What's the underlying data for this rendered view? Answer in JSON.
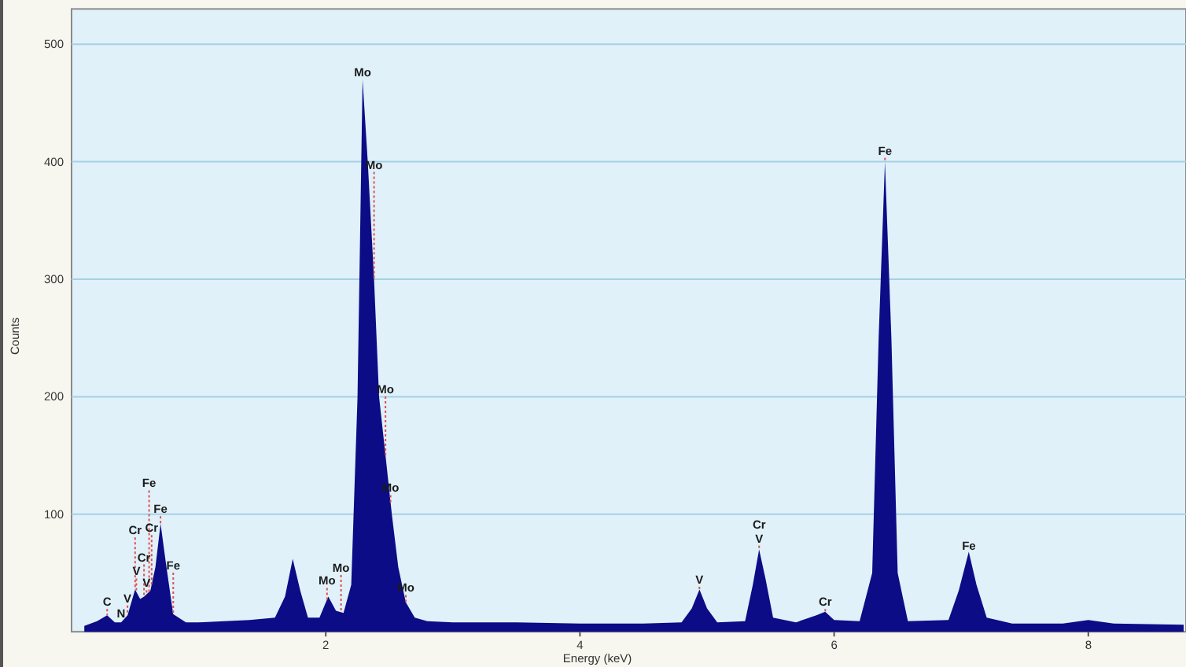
{
  "chart_data": {
    "type": "area",
    "grid": true,
    "xlabel": "Energy (keV)",
    "ylabel": "Counts",
    "xlim": [
      0,
      8.77
    ],
    "ylim": [
      0,
      530
    ],
    "xticks": [
      2,
      4,
      6,
      8
    ],
    "yticks": [
      100,
      200,
      300,
      400,
      500
    ],
    "x": [
      0.1,
      0.2,
      0.28,
      0.34,
      0.39,
      0.44,
      0.5,
      0.54,
      0.57,
      0.62,
      0.66,
      0.7,
      0.74,
      0.8,
      0.9,
      1.0,
      1.2,
      1.4,
      1.6,
      1.68,
      1.74,
      1.8,
      1.86,
      1.95,
      2.02,
      2.08,
      2.14,
      2.2,
      2.25,
      2.29,
      2.33,
      2.38,
      2.42,
      2.47,
      2.52,
      2.57,
      2.63,
      2.7,
      2.8,
      3.0,
      3.5,
      4.0,
      4.5,
      4.8,
      4.88,
      4.94,
      5.0,
      5.08,
      5.3,
      5.36,
      5.41,
      5.46,
      5.52,
      5.7,
      5.86,
      5.93,
      6.0,
      6.2,
      6.3,
      6.35,
      6.4,
      6.45,
      6.5,
      6.58,
      6.9,
      6.98,
      7.06,
      7.12,
      7.2,
      7.4,
      7.8,
      8.0,
      8.2,
      8.75
    ],
    "values": [
      5,
      9,
      14,
      8,
      8,
      14,
      36,
      28,
      30,
      35,
      55,
      92,
      60,
      15,
      8,
      8,
      9,
      10,
      12,
      30,
      62,
      35,
      12,
      12,
      30,
      18,
      16,
      40,
      200,
      470,
      400,
      300,
      200,
      150,
      100,
      55,
      25,
      12,
      9,
      8,
      8,
      7,
      7,
      8,
      20,
      36,
      20,
      8,
      9,
      40,
      70,
      45,
      12,
      8,
      14,
      17,
      10,
      9,
      50,
      250,
      400,
      250,
      50,
      9,
      10,
      35,
      68,
      40,
      12,
      7,
      7,
      10,
      7,
      6
    ],
    "annotations": [
      "C",
      {
        "text": "N",
        "x": 0.39,
        "y": 12
      },
      {
        "text": "V",
        "x": 0.44,
        "y": 25
      },
      "V",
      "Cr",
      "Cr",
      {
        "text": "V",
        "x": 0.59,
        "y": 38
      },
      "Fe",
      "Cr",
      "Fe",
      {
        "text": "Fe",
        "x": 0.8,
        "y": 53
      },
      "Mo",
      "Mo",
      {
        "text": "Mo",
        "x": 2.29,
        "y": 473
      },
      {
        "text": "Mo",
        "x": 2.38,
        "y": 394
      },
      {
        "text": "Mo",
        "x": 2.47,
        "y": 203
      },
      {
        "text": "Mo",
        "x": 2.51,
        "y": 119
      },
      {
        "text": "Mo",
        "x": 2.63,
        "y": 34
      },
      {
        "text": "V",
        "x": 4.94,
        "y": 41
      },
      "Cr",
      {
        "text": "V",
        "x": 5.41,
        "y": 76
      },
      {
        "text": "Cr",
        "x": 5.93,
        "y": 22
      },
      {
        "text": "Fe",
        "x": 6.4,
        "y": 406
      },
      {
        "text": "Fe",
        "x": 7.06,
        "y": 70
      }
    ]
  }
}
